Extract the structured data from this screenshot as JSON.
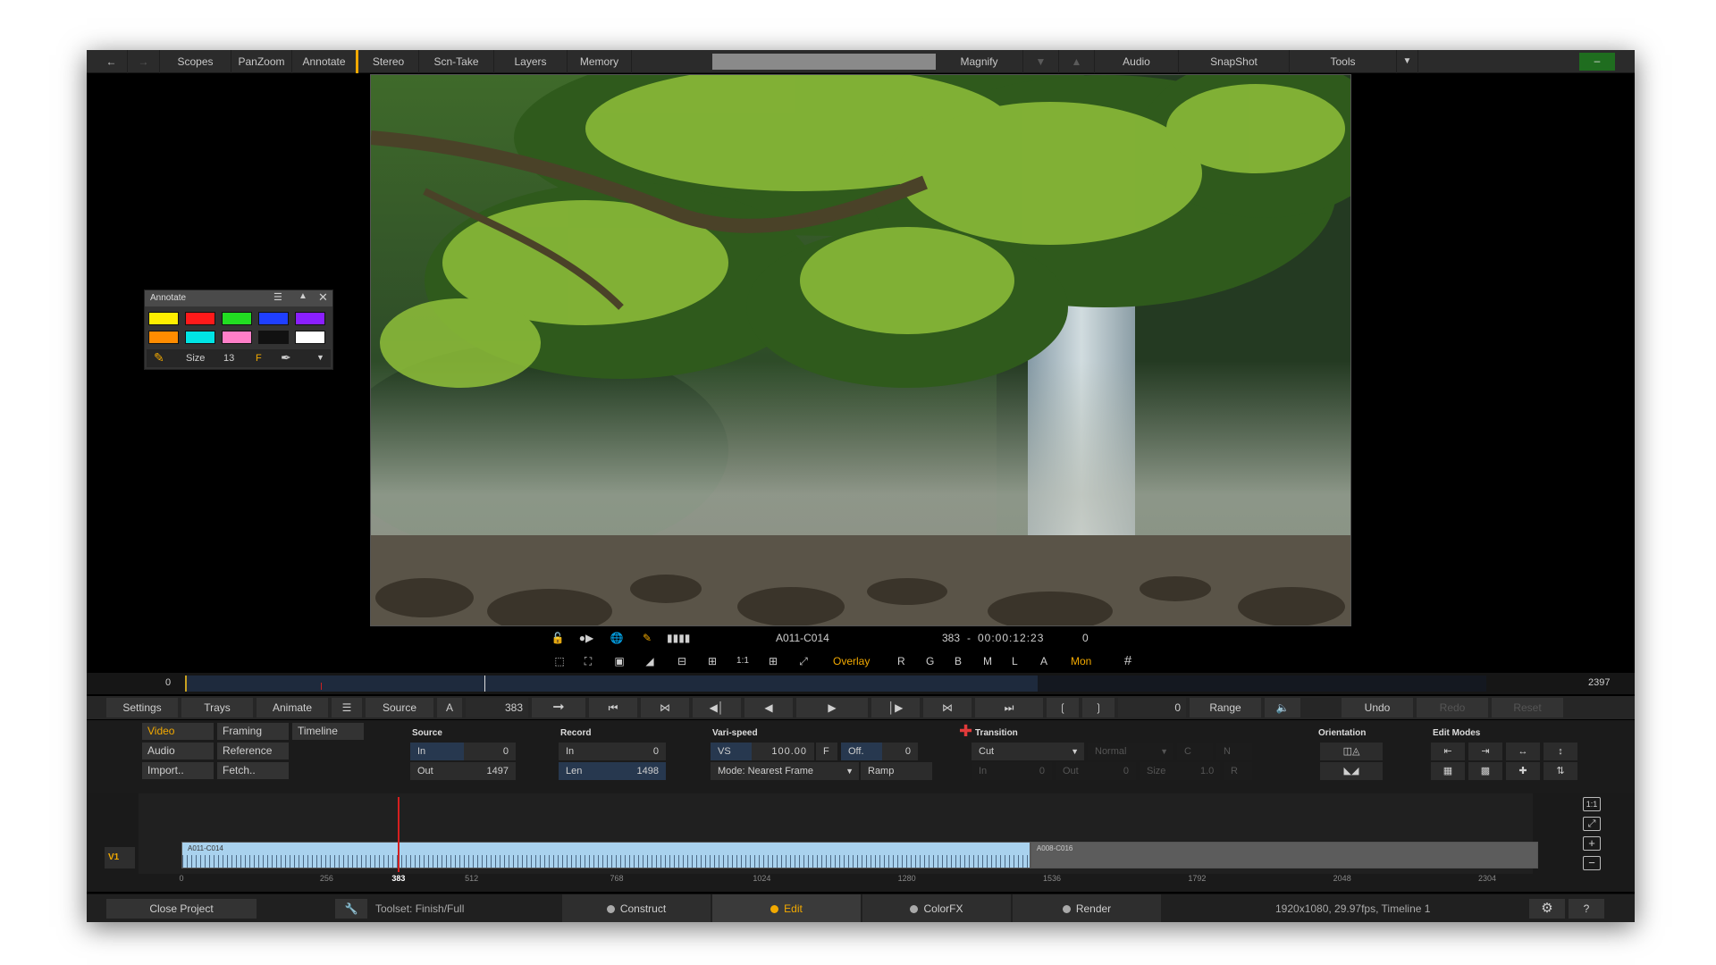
{
  "menu": {
    "back_icon": "back-arrow-icon",
    "forward_icon": "forward-arrow-icon",
    "items": [
      "Scopes",
      "PanZoom",
      "Annotate",
      "Stereo",
      "Scn-Take",
      "Layers",
      "Memory"
    ],
    "magnify": "Magnify",
    "audio": "Audio",
    "snapshot": "SnapShot",
    "tools": "Tools",
    "minimize": "–"
  },
  "annotate": {
    "title": "Annotate",
    "colors": [
      "#ffee00",
      "#ff1a1a",
      "#22dd22",
      "#1f3fff",
      "#8a1fff",
      "#ff8c00",
      "#00e5e5",
      "#ff7fc8",
      "#111111",
      "#ffffff"
    ],
    "size_label": "Size",
    "size_value": "13",
    "f_label": "F"
  },
  "viewer": {
    "clip_name": "A011-C014",
    "frame": "383",
    "timecode": "00:00:12:23",
    "counter": "0",
    "overlay": "Overlay",
    "channels": [
      "R",
      "G",
      "B",
      "M",
      "L",
      "A"
    ],
    "mon": "Mon",
    "one_to_one": "1:1"
  },
  "scrub": {
    "start": "0",
    "end": "2397",
    "position_frame": 383
  },
  "controlbar": {
    "settings": "Settings",
    "trays": "Trays",
    "animate": "Animate",
    "source": "Source",
    "a": "A",
    "frame": "383",
    "range_value": "0",
    "range": "Range",
    "undo": "Undo",
    "redo": "Redo",
    "reset": "Reset"
  },
  "left_tabs": [
    "Video",
    "Framing",
    "Timeline",
    "Audio",
    "Reference",
    "Import..",
    "Fetch.."
  ],
  "source": {
    "title": "Source",
    "in_label": "In",
    "in_value": "0",
    "out_label": "Out",
    "out_value": "1497"
  },
  "record": {
    "title": "Record",
    "in_label": "In",
    "in_value": "0",
    "len_label": "Len",
    "len_value": "1498"
  },
  "varispeed": {
    "title": "Vari-speed",
    "vs": "VS",
    "vs_value": "100.00",
    "f": "F",
    "off": "Off.",
    "off_value": "0",
    "mode": "Mode: Nearest Frame",
    "ramp": "Ramp"
  },
  "transition": {
    "title": "Transition",
    "type": "Cut",
    "normal": "Normal",
    "c": "C",
    "n": "N",
    "in_label": "In",
    "in_value": "0",
    "out_label": "Out",
    "out_value": "0",
    "size_label": "Size",
    "size_value": "1.0",
    "r": "R"
  },
  "orientation": {
    "title": "Orientation"
  },
  "edit_modes": {
    "title": "Edit Modes"
  },
  "timeline": {
    "track": "V1",
    "clips": [
      "A011-C014",
      "A008-C016"
    ],
    "clip_split_frame": 1498,
    "total_frames": 2397,
    "ruler": [
      "0",
      "256",
      "383",
      "512",
      "768",
      "1024",
      "1280",
      "1536",
      "1792",
      "2048",
      "2304"
    ]
  },
  "footer": {
    "close_project": "Close Project",
    "toolset": "Toolset: Finish/Full",
    "tabs": [
      "Construct",
      "Edit",
      "ColorFX",
      "Render"
    ],
    "active_tab": "Edit",
    "info": "1920x1080, 29.97fps, Timeline 1",
    "help": "?"
  }
}
